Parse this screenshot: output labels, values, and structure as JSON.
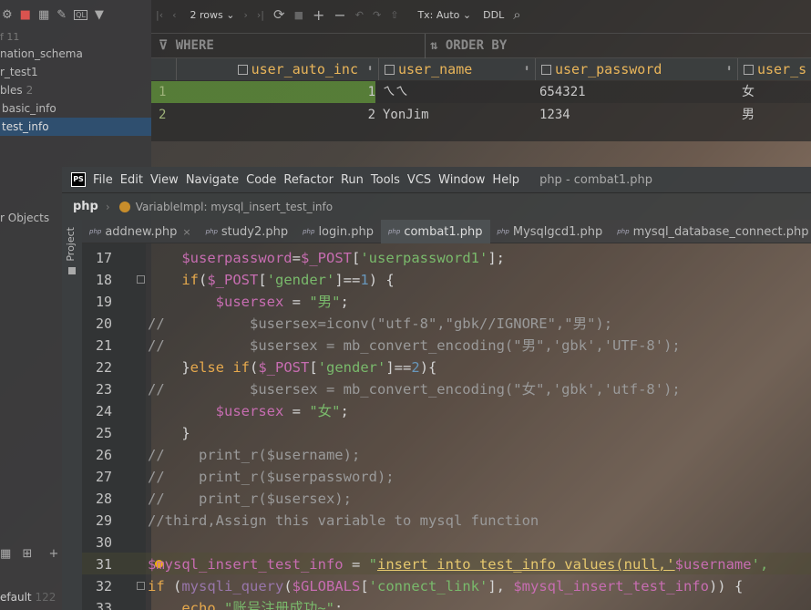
{
  "db_left": {
    "count": "f 11",
    "tree": [
      {
        "label": "nation_schema"
      },
      {
        "label": "r_test1"
      },
      {
        "label": "bles",
        "count": "2"
      },
      {
        "label": "basic_info"
      },
      {
        "label": "test_info"
      }
    ],
    "objects_label": "r Objects",
    "status_default": "efault",
    "status_count": "122"
  },
  "grid": {
    "rows_selector": "2 rows",
    "tx_selector": "Tx: Auto",
    "ddl_label": "DDL",
    "where_label": "WHERE",
    "order_label": "ORDER BY",
    "columns": [
      "user_auto_inc",
      "user_name",
      "user_password",
      "user_s"
    ],
    "rows": [
      {
        "num": "1",
        "auto_inc": "1",
        "name": "ㄟㄟ",
        "password": "654321",
        "sex": "女"
      },
      {
        "num": "2",
        "auto_inc": "2",
        "name": "YonJim",
        "password": "1234",
        "sex": "男"
      }
    ]
  },
  "ide": {
    "logo": "PS",
    "menu": [
      "File",
      "Edit",
      "View",
      "Navigate",
      "Code",
      "Refactor",
      "Run",
      "Tools",
      "VCS",
      "Window",
      "Help"
    ],
    "window_title": "php - combat1.php",
    "nav_root": "php",
    "nav_item": "VariableImpl: mysql_insert_test_info",
    "project_label": "Project",
    "tabs": [
      "addnew.php",
      "study2.php",
      "login.php",
      "combat1.php",
      "Mysqlgcd1.php",
      "mysql_database_connect.php"
    ],
    "line_numbers": [
      "17",
      "18",
      "19",
      "20",
      "21",
      "22",
      "23",
      "24",
      "25",
      "26",
      "27",
      "28",
      "29",
      "30",
      "31",
      "32",
      "33"
    ]
  },
  "colors": {
    "keyword": "#e6a94d",
    "string": "#79b96b",
    "variable": "#c76db1",
    "header_text": "#e9b55a",
    "selection": "#2f4f6f",
    "row_highlight": "#5d8a3a"
  },
  "icons": [
    "gear-icon",
    "stop-icon",
    "grid-icon",
    "edit-icon",
    "ql-icon",
    "filter-icon",
    "refresh-icon",
    "plus-icon",
    "minus-icon",
    "undo-icon",
    "redo-icon",
    "up-icon",
    "search-icon",
    "table-icon",
    "php-file-icon"
  ]
}
